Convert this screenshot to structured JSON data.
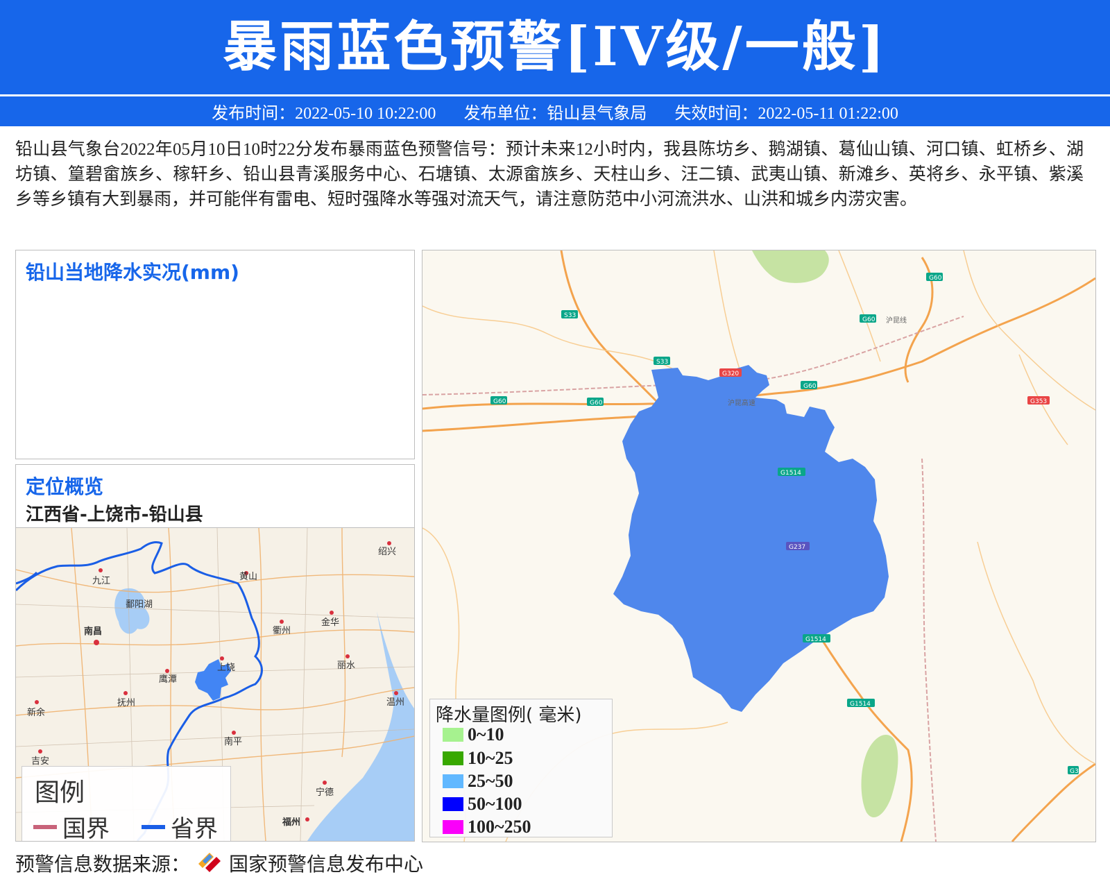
{
  "header": {
    "title": "暴雨蓝色预警[IV级/一般]",
    "issue_time": "发布时间：2022-05-10 10:22:00",
    "issuer": "发布单位：铅山县气象局",
    "expire_time": "失效时间：2022-05-11 01:22:00",
    "color": "#1766ea"
  },
  "warning_text": "铅山县气象台2022年05月10日10时22分发布暴雨蓝色预警信号：预计未来12小时内，我县陈坊乡、鹅湖镇、葛仙山镇、河口镇、虹桥乡、湖坊镇、篁碧畲族乡、稼轩乡、铅山县青溪服务中心、石塘镇、太源畲族乡、天柱山乡、汪二镇、武夷山镇、新滩乡、英将乡、永平镇、紫溪乡等乡镇有大到暴雨，并可能伴有雷电、短时强降水等强对流天气，请注意防范中小河流洪水、山洪和城乡内涝灾害。",
  "rain_panel": {
    "title": "铅山当地降水实况(mm)"
  },
  "location_panel": {
    "title": "定位概览",
    "path": "江西省-上饶市-铅山县",
    "cities": [
      "九江",
      "黄山",
      "绍兴",
      "鄱阳湖",
      "南昌",
      "衢州",
      "金华",
      "上饶",
      "鹰潭",
      "丽水",
      "抚州",
      "新余",
      "温州",
      "南平",
      "吉安",
      "宁德",
      "福州"
    ],
    "legend_title": "图例",
    "legend_items": [
      {
        "label": "国界",
        "color": "#c8637a"
      },
      {
        "label": "省界",
        "color": "#1a5ee6"
      }
    ],
    "highlight_color": "#4285f4"
  },
  "main_map": {
    "road_labels": [
      "G60",
      "G60",
      "G60",
      "G60",
      "G60",
      "S33",
      "S33",
      "G320",
      "G353",
      "G1514",
      "G237",
      "G1514",
      "G1514",
      "G3"
    ],
    "rail_labels": [
      "沪昆线",
      "沪昆高速"
    ],
    "county_fill": "#4f87ec",
    "legend_title": "降水量图例( 毫米)",
    "legend": [
      {
        "label": "0~10",
        "color": "#a6f28f"
      },
      {
        "label": "10~25",
        "color": "#38a800"
      },
      {
        "label": "25~50",
        "color": "#61b8ff"
      },
      {
        "label": "50~100",
        "color": "#0000ff"
      },
      {
        "label": "100~250",
        "color": "#fa00fa"
      }
    ]
  },
  "footer": {
    "source_label": "预警信息数据来源：",
    "source_name": "国家预警信息发布中心"
  }
}
